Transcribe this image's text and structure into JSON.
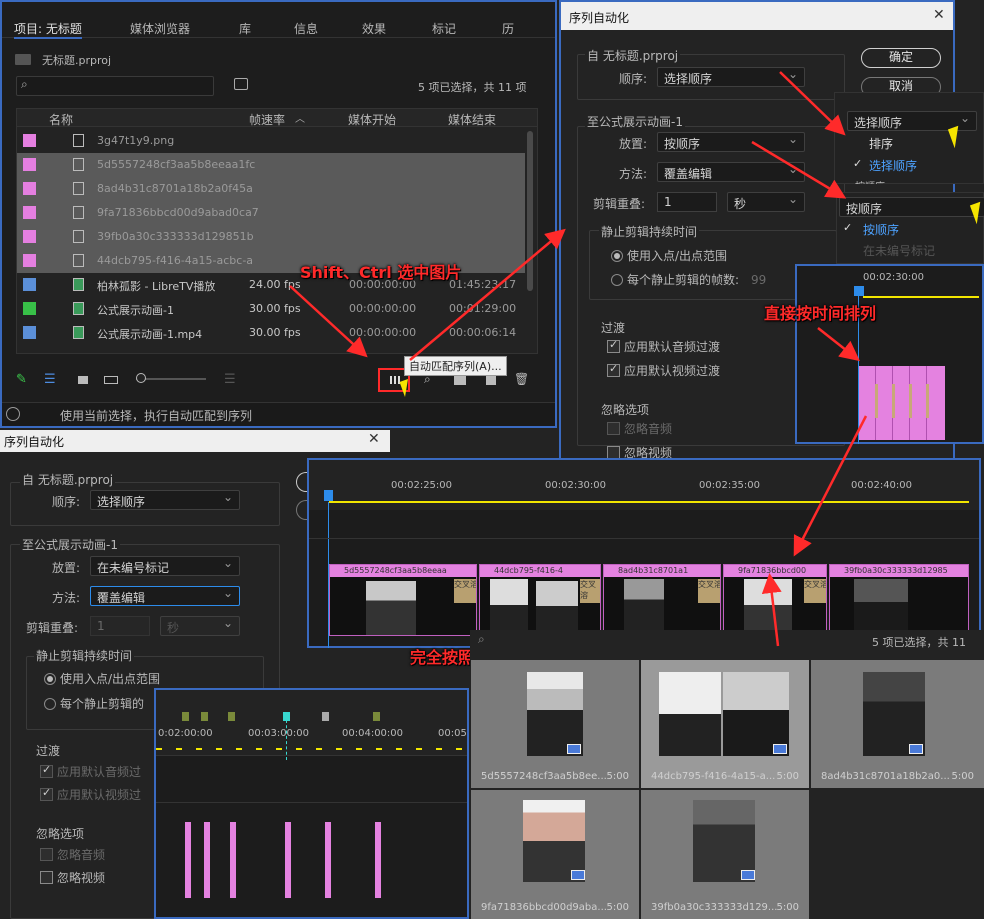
{
  "project_panel": {
    "tabs": [
      "项目: 无标题",
      "媒体浏览器",
      "库",
      "信息",
      "效果",
      "标记",
      "历"
    ],
    "file_name": "无标题.prproj",
    "search_placeholder": "",
    "selection_count": "5 项已选择，共 11 项",
    "columns": [
      "名称",
      "帧速率",
      "媒体开始",
      "媒体结束"
    ],
    "rows": [
      {
        "name": "3g47t1y9.png",
        "fps": "",
        "start": "",
        "end": "",
        "color": "#e47fe0",
        "selected": false
      },
      {
        "name": "5d5557248cf3aa5b8eeaa1fc",
        "fps": "",
        "start": "",
        "end": "",
        "color": "#e47fe0",
        "selected": true
      },
      {
        "name": "8ad4b31c8701a18b2a0f45a",
        "fps": "",
        "start": "",
        "end": "",
        "color": "#e47fe0",
        "selected": true
      },
      {
        "name": "9fa71836bbcd00d9abad0ca7",
        "fps": "",
        "start": "",
        "end": "",
        "color": "#e47fe0",
        "selected": true
      },
      {
        "name": "39fb0a30c333333d129851b",
        "fps": "",
        "start": "",
        "end": "",
        "color": "#e47fe0",
        "selected": true
      },
      {
        "name": "44dcb795-f416-4a15-acbc-a",
        "fps": "",
        "start": "",
        "end": "",
        "color": "#e47fe0",
        "selected": true
      },
      {
        "name": "柏林孤影 - LibreTV播放",
        "fps": "24.00 fps",
        "start": "00:00:00:00",
        "end": "01:45:23:17",
        "color": "#5b8fd8",
        "selected": false
      },
      {
        "name": "公式展示动画-1",
        "fps": "30.00 fps",
        "start": "00:00:00:00",
        "end": "00:01:29:00",
        "color": "#38c048",
        "selected": false
      },
      {
        "name": "公式展示动画-1.mp4",
        "fps": "30.00 fps",
        "start": "00:00:00:00",
        "end": "00:00:06:14",
        "color": "#5b8fd8",
        "selected": false
      }
    ],
    "tooltip": "自动匹配序列(A)...",
    "status": "使用当前选择，执行自动匹配到序列"
  },
  "annotations": {
    "shift_ctrl": "Shift、Ctrl 选中图片",
    "by_time": "直接按时间排列",
    "by_selection": "完全按照素材的排列选择顺序添加到轨道"
  },
  "dialog_right": {
    "title": "序列自动化",
    "from_label": "自 无标题.prproj",
    "order_label": "顺序:",
    "order_value": "选择顺序",
    "ok": "确定",
    "cancel": "取消",
    "to_label": "至公式展示动画-1",
    "placement_label": "放置:",
    "placement_value": "按顺序",
    "method_label": "方法:",
    "method_value": "覆盖编辑",
    "overlap_label": "剪辑重叠:",
    "overlap_value": "1",
    "overlap_unit": "秒",
    "still_group": "静止剪辑持续时间",
    "use_inout": "使用入点/出点范围",
    "frames_per_still": "每个静止剪辑的帧数:",
    "frames_value": "99",
    "transitions": "过渡",
    "audio_trans": "应用默认音频过渡",
    "video_trans": "应用默认视频过渡",
    "ignore": "忽略选项",
    "ignore_audio": "忽略音频",
    "ignore_video": "忽略视频"
  },
  "order_dropdown": {
    "current": "选择顺序",
    "options": [
      "排序",
      "选择顺序"
    ],
    "checked": "选择顺序",
    "next_peek": "按顺序"
  },
  "placement_dropdown": {
    "current": "按顺序",
    "options": [
      "按顺序",
      "在未编号标记"
    ],
    "checked": "按顺序",
    "peek_unit": "秒"
  },
  "timeline_right": {
    "time_label": "00:02:30:00"
  },
  "dialog_left": {
    "title": "序列自动化",
    "close": "✕",
    "from_label": "自 无标题.prproj",
    "order_label": "顺序:",
    "order_value": "选择顺序",
    "to_label": "至公式展示动画-1",
    "placement_label": "放置:",
    "placement_value": "在未编号标记",
    "method_label": "方法:",
    "method_value": "覆盖编辑",
    "overlap_label": "剪辑重叠:",
    "overlap_value": "1",
    "overlap_unit": "秒",
    "still_group": "静止剪辑持续时间",
    "use_inout": "使用入点/出点范围",
    "frames_per_still": "每个静止剪辑的",
    "transitions": "过渡",
    "audio_trans": "应用默认音频过",
    "video_trans": "应用默认视频过",
    "ignore": "忽略选项",
    "ignore_audio": "忽略音频",
    "ignore_video": "忽略视频"
  },
  "timeline_left": {
    "ticks": [
      "0:02:00:00",
      "00:03:00:00",
      "00:04:00:00",
      "00:05"
    ]
  },
  "timeline_main": {
    "ticks": [
      "00:02:25:00",
      "00:02:30:00",
      "00:02:35:00",
      "00:02:40:00"
    ],
    "clips": [
      {
        "label": "5d5557248cf3aa5b8eeaa"
      },
      {
        "label": "44dcb795-f416-4"
      },
      {
        "label": "8ad4b31c8701a1"
      },
      {
        "label": "9fa71836bbcd00"
      },
      {
        "label": "39fb0a30c333333d12985"
      }
    ],
    "transition_label": "交叉溶"
  },
  "bin": {
    "count": "5 项已选择，共 11",
    "items": [
      {
        "name": "5d5557248cf3aa5b8ee...",
        "duration": "5:00"
      },
      {
        "name": "44dcb795-f416-4a15-a...",
        "duration": "5:00"
      },
      {
        "name": "8ad4b31c8701a18b2a0...",
        "duration": "5:00"
      },
      {
        "name": "9fa71836bbcd00d9aba...",
        "duration": "5:00"
      },
      {
        "name": "39fb0a30c333333d129...",
        "duration": "5:00"
      }
    ]
  },
  "colors": {
    "accent_red": "#ff2a2a",
    "clip_pink": "#e482e0",
    "selection_blue": "#2d8ceb",
    "playhead_yellow": "#f2e600"
  }
}
